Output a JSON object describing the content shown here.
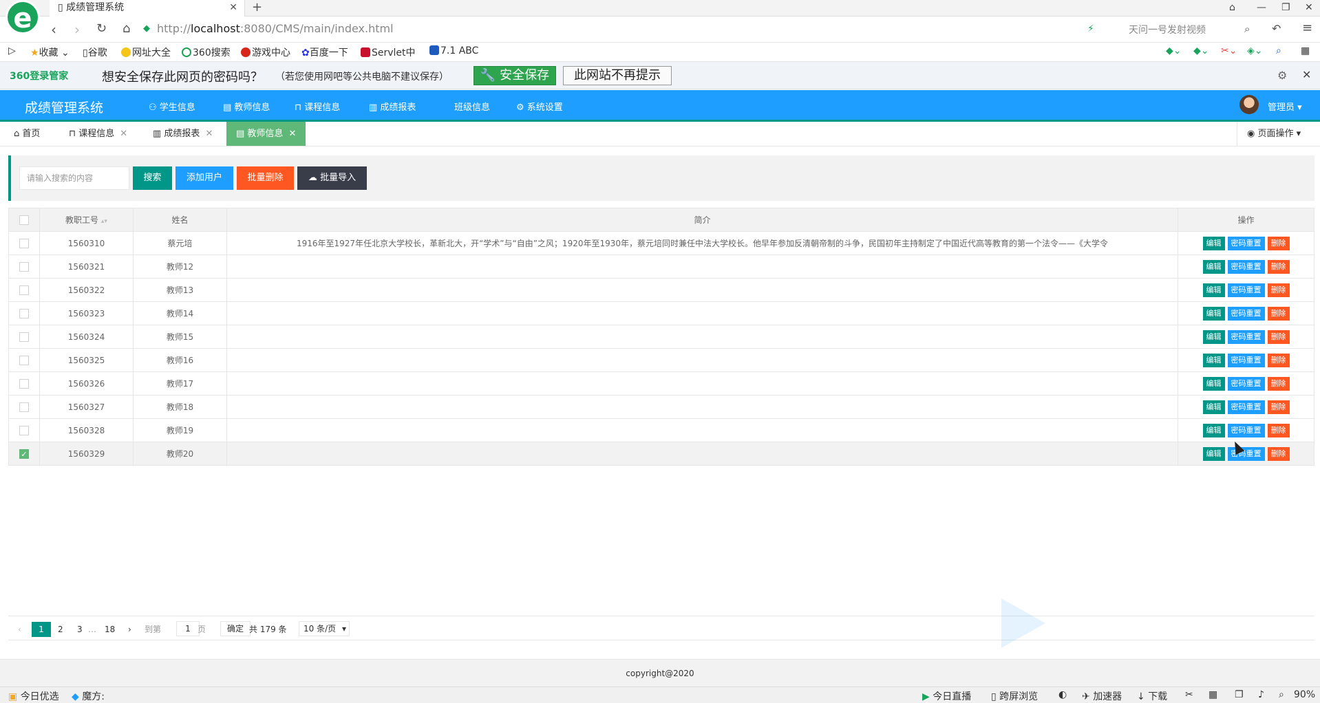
{
  "browser": {
    "tab_title": "成绩管理系统",
    "url_prefix": "http://",
    "url_host": "localhost",
    "url_rest": ":8080/CMS/main/index.html",
    "search_hint": "天问一号发射视频"
  },
  "bookmarks": [
    "收藏",
    "谷歌",
    "网址大全",
    "360搜索",
    "游戏中心",
    "百度一下",
    "Servlet中",
    "7.1 ABC"
  ],
  "password_bar": {
    "brand": "360登录管家",
    "question": "想安全保存此网页的密码吗？",
    "note": "（若您使用网吧等公共电脑不建议保存）",
    "save_label": "安全保存",
    "never_label": "此网站不再提示"
  },
  "app": {
    "title": "成绩管理系统",
    "nav": [
      "学生信息",
      "教师信息",
      "课程信息",
      "成绩报表",
      "班级信息",
      "系统设置"
    ],
    "user": "管理员"
  },
  "page_tabs": {
    "home": "首页",
    "items": [
      "课程信息",
      "成绩报表",
      "教师信息"
    ],
    "page_ops": "页面操作"
  },
  "toolbar": {
    "search_placeholder": "请输入搜索的内容",
    "search_label": "搜索",
    "add_label": "添加用户",
    "batch_delete_label": "批量删除",
    "batch_import_label": "批量导入"
  },
  "table": {
    "headers": [
      "教职工号",
      "姓名",
      "简介",
      "操作"
    ],
    "action_labels": {
      "edit": "编辑",
      "reset": "密码重置",
      "delete": "删除"
    },
    "rows": [
      {
        "id": "1560310",
        "name": "蔡元培",
        "intro": "1916年至1927年任北京大学校长，革新北大，开“学术”与“自由”之风；1920年至1930年，蔡元培同时兼任中法大学校长。他早年参加反清朝帝制的斗争，民国初年主持制定了中国近代高等教育的第一个法令——《大学令",
        "checked": false
      },
      {
        "id": "1560321",
        "name": "教师12",
        "intro": "",
        "checked": false
      },
      {
        "id": "1560322",
        "name": "教师13",
        "intro": "",
        "checked": false
      },
      {
        "id": "1560323",
        "name": "教师14",
        "intro": "",
        "checked": false
      },
      {
        "id": "1560324",
        "name": "教师15",
        "intro": "",
        "checked": false
      },
      {
        "id": "1560325",
        "name": "教师16",
        "intro": "",
        "checked": false
      },
      {
        "id": "1560326",
        "name": "教师17",
        "intro": "",
        "checked": false
      },
      {
        "id": "1560327",
        "name": "教师18",
        "intro": "",
        "checked": false
      },
      {
        "id": "1560328",
        "name": "教师19",
        "intro": "",
        "checked": false
      },
      {
        "id": "1560329",
        "name": "教师20",
        "intro": "",
        "checked": true
      }
    ]
  },
  "pager": {
    "current": "1",
    "pages": [
      "2",
      "3"
    ],
    "ellipsis": "…",
    "last": "18",
    "goto_label": "到第",
    "goto_value": "1",
    "page_unit": "页",
    "confirm_label": "确定",
    "total": "共 179 条",
    "page_size": "10 条/页"
  },
  "footer": {
    "copyright": "copyright@2020"
  },
  "statusbar": {
    "left": [
      "今日优选",
      "魔方:"
    ],
    "right": [
      "今日直播",
      "跨屏浏览",
      "加速器",
      "下载",
      "90%"
    ]
  },
  "colors": {
    "primary": "#1e9fff",
    "accent": "#009688",
    "danger": "#ff5722",
    "success": "#5fb878",
    "dark": "#393d49"
  }
}
